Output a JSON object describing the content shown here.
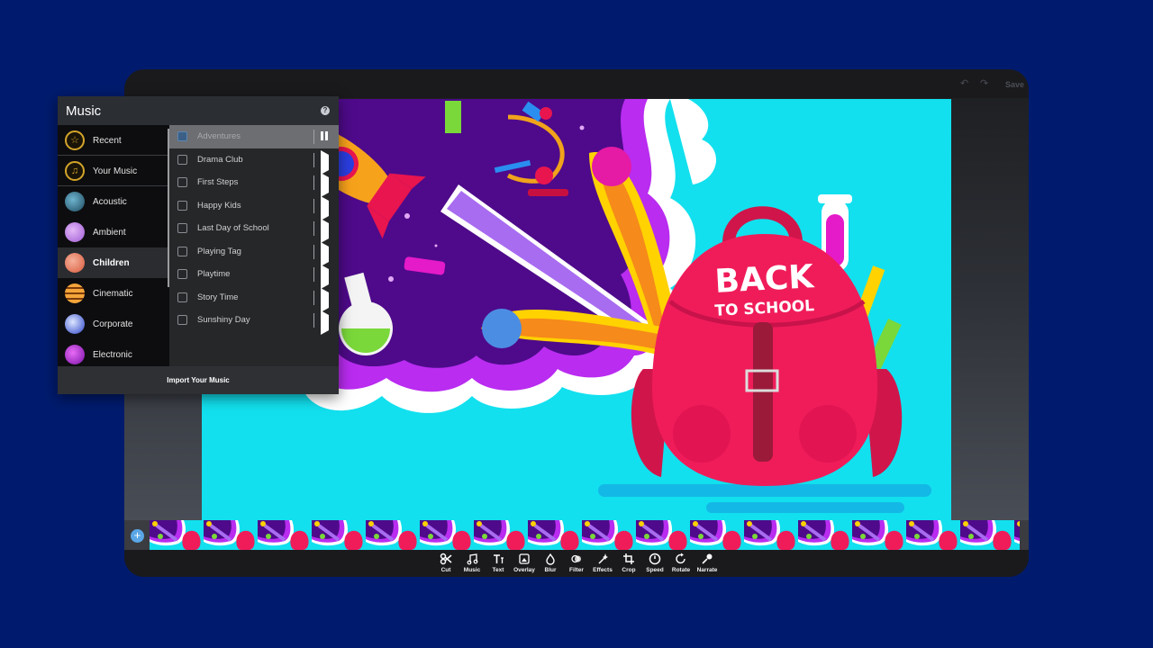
{
  "topbar": {
    "undo_icon": "undo-icon",
    "redo_icon": "redo-icon",
    "save_label": "Save"
  },
  "canvas": {
    "headline": "BACK",
    "subheadline": "TO SCHOOL",
    "background_color": "#12e0ee"
  },
  "music_panel": {
    "title": "Music",
    "help_label": "?",
    "categories": [
      {
        "label": "Recent",
        "icon": "star-icon",
        "active": false
      },
      {
        "label": "Your Music",
        "icon": "music-note-icon",
        "active": false
      },
      {
        "label": "Acoustic",
        "icon": "acoustic-thumb",
        "active": false
      },
      {
        "label": "Ambient",
        "icon": "ambient-thumb",
        "active": false
      },
      {
        "label": "Children",
        "icon": "children-thumb",
        "active": true
      },
      {
        "label": "Cinematic",
        "icon": "cinematic-thumb",
        "active": false
      },
      {
        "label": "Corporate",
        "icon": "corporate-thumb",
        "active": false
      },
      {
        "label": "Electronic",
        "icon": "electronic-thumb",
        "active": false
      }
    ],
    "tracks": [
      {
        "name": "Adventures",
        "state": "playing"
      },
      {
        "name": "Drama Club",
        "state": "stopped"
      },
      {
        "name": "First Steps",
        "state": "stopped"
      },
      {
        "name": "Happy Kids",
        "state": "stopped"
      },
      {
        "name": "Last Day of School",
        "state": "stopped"
      },
      {
        "name": "Playing Tag",
        "state": "stopped"
      },
      {
        "name": "Playtime",
        "state": "stopped"
      },
      {
        "name": "Story Time",
        "state": "stopped"
      },
      {
        "name": "Sunshiny Day",
        "state": "stopped"
      }
    ],
    "import_label": "Import Your Music"
  },
  "timeline": {
    "add_label": "+",
    "thumbnail_count": 17
  },
  "toolbar": {
    "tools": [
      {
        "label": "Cut",
        "icon": "scissors-icon"
      },
      {
        "label": "Music",
        "icon": "music-note-icon"
      },
      {
        "label": "Text",
        "icon": "text-icon"
      },
      {
        "label": "Overlay",
        "icon": "overlay-icon"
      },
      {
        "label": "Blur",
        "icon": "droplet-icon"
      },
      {
        "label": "Filter",
        "icon": "filter-icon"
      },
      {
        "label": "Effects",
        "icon": "magic-wand-icon"
      },
      {
        "label": "Crop",
        "icon": "crop-icon"
      },
      {
        "label": "Speed",
        "icon": "speedometer-icon"
      },
      {
        "label": "Rotate",
        "icon": "rotate-icon"
      },
      {
        "label": "Narrate",
        "icon": "microphone-icon"
      }
    ]
  },
  "colors": {
    "backdrop": "#001b6e",
    "frame": "#1a1a1d",
    "accent_blue": "#5aa6e6",
    "gold": "#d4a52a"
  }
}
